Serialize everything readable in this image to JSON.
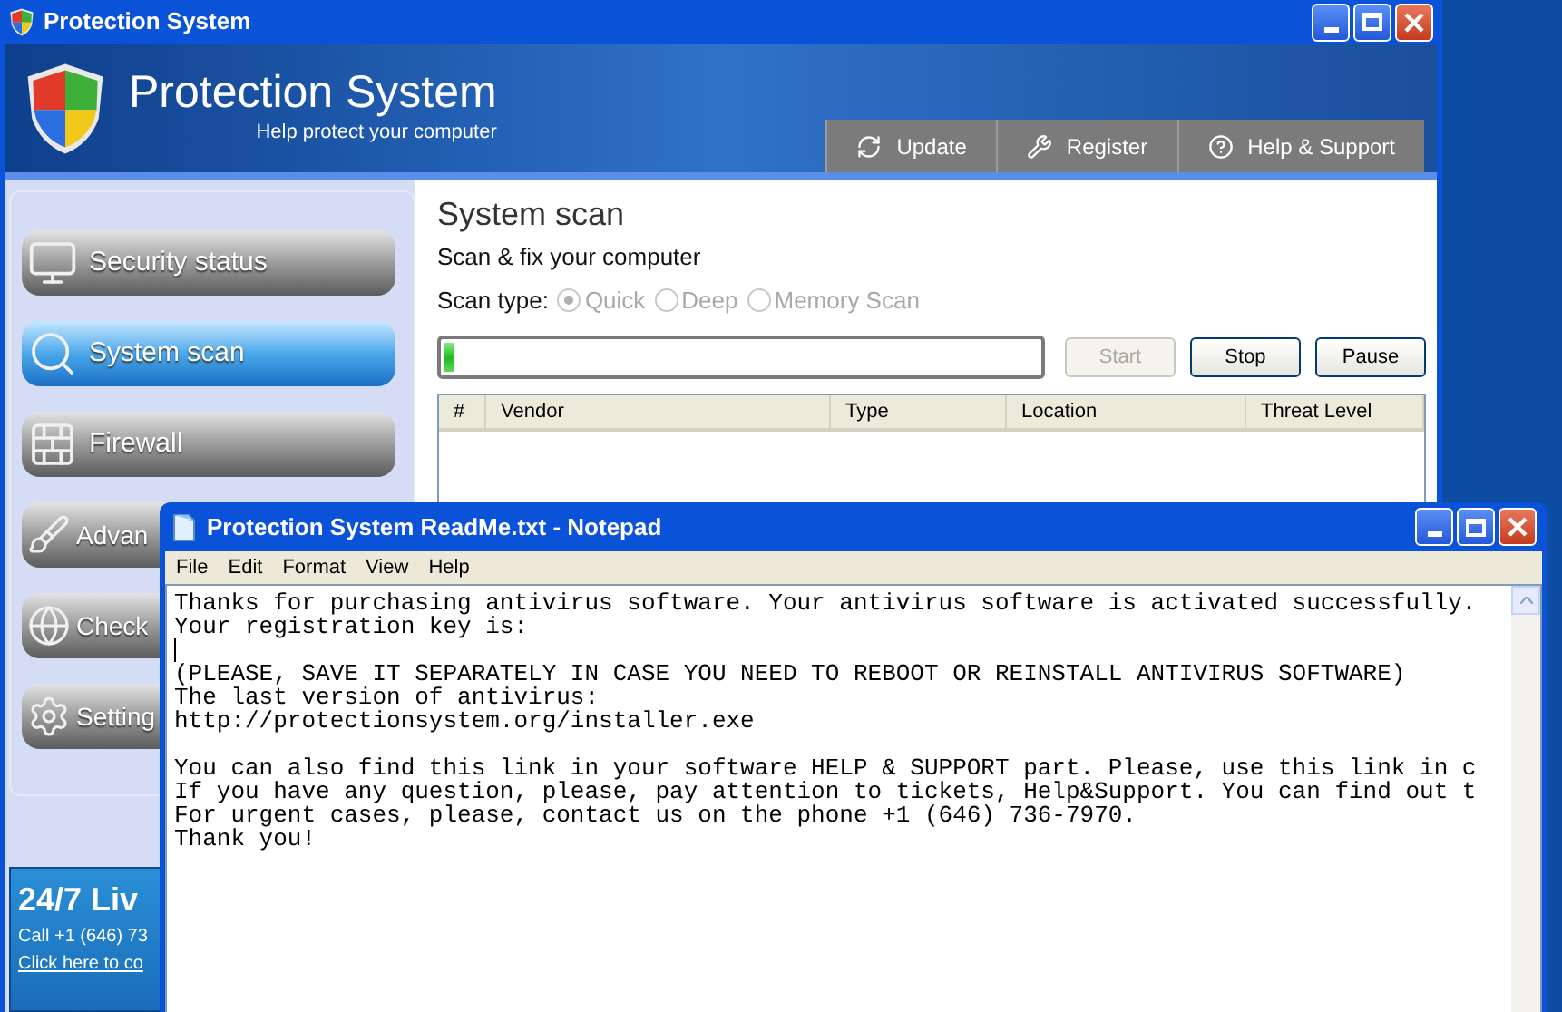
{
  "window": {
    "title": "Protection System"
  },
  "header": {
    "title": "Protection System",
    "subtitle": "Help protect your computer"
  },
  "toolbar_buttons": [
    {
      "label": "Update",
      "kind": "update"
    },
    {
      "label": "Register",
      "kind": "register"
    },
    {
      "label": "Help & Support",
      "kind": "help"
    }
  ],
  "sidebar": {
    "items": [
      {
        "label": "Security status",
        "kind": "monitor",
        "selected": false
      },
      {
        "label": "System scan",
        "kind": "scan",
        "selected": true
      },
      {
        "label": "Firewall",
        "kind": "firewall",
        "selected": false
      },
      {
        "label": "Advan",
        "kind": "broom",
        "selected": false
      },
      {
        "label": "Check",
        "kind": "globe",
        "selected": false
      },
      {
        "label": "Setting",
        "kind": "gear",
        "selected": false
      }
    ]
  },
  "live_chat": {
    "title": "24/7 Liv",
    "phone": "Call +1 (646) 73",
    "link": "Click here to co"
  },
  "scan": {
    "title": "System scan",
    "subtitle": "Scan & fix your computer",
    "scan_type_label": "Scan type:",
    "scan_types": [
      {
        "label": "Quick",
        "selected": true,
        "disabled": true
      },
      {
        "label": "Deep",
        "selected": false,
        "disabled": true
      },
      {
        "label": "Memory Scan",
        "selected": false,
        "disabled": true
      }
    ],
    "progress": {
      "level": 0.015
    },
    "buttons": [
      {
        "label": "Start",
        "disabled": true
      },
      {
        "label": "Stop",
        "disabled": false
      },
      {
        "label": "Pause",
        "disabled": false
      }
    ],
    "table": {
      "columns": [
        "#",
        "Vendor",
        "Type",
        "Location",
        "Threat Level"
      ]
    }
  },
  "notepad": {
    "title": "Protection System ReadMe.txt - Notepad",
    "menu": [
      "File",
      "Edit",
      "Format",
      "View",
      "Help"
    ],
    "lines": [
      {
        "kind": "text",
        "text": "Thanks for purchasing antivirus software. Your antivirus software is activated successfully."
      },
      {
        "kind": "text",
        "text": "Your registration key is:"
      },
      {
        "kind": "caret"
      },
      {
        "kind": "text",
        "text": "(PLEASE, SAVE IT SEPARATELY IN CASE YOU NEED TO REBOOT OR REINSTALL ANTIVIRUS SOFTWARE)"
      },
      {
        "kind": "text",
        "text": "The last version of antivirus:"
      },
      {
        "kind": "text",
        "text": "http://protectionsystem.org/installer.exe"
      },
      {
        "kind": "blank"
      },
      {
        "kind": "text",
        "text": "You can also find this link in your software HELP & SUPPORT part. Please, use this link in c"
      },
      {
        "kind": "text",
        "text": "If you have any question, please, pay attention to tickets, Help&Support. You can find out t"
      },
      {
        "kind": "text",
        "text": "For urgent cases, please, contact us on the phone +1 (646) 736-7970."
      },
      {
        "kind": "text",
        "text": "Thank you!"
      }
    ]
  }
}
